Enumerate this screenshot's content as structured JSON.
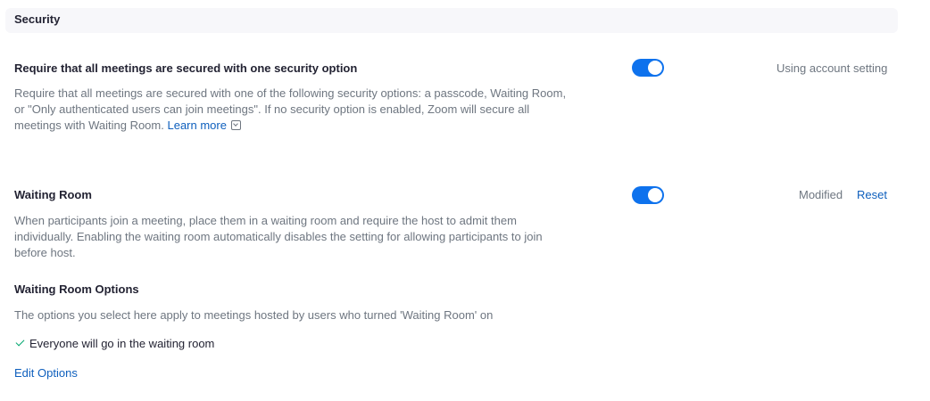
{
  "section": {
    "title": "Security"
  },
  "settings": {
    "require_security": {
      "title": "Require that all meetings are secured with one security option",
      "description": "Require that all meetings are secured with one of the following security options: a passcode, Waiting Room, or \"Only authenticated users can join meetings\". If no security option is enabled, Zoom will secure all meetings with Waiting Room.",
      "learn_more": "Learn more",
      "enabled": true,
      "status": "Using account setting"
    },
    "waiting_room": {
      "title": "Waiting Room",
      "description": "When participants join a meeting, place them in a waiting room and require the host to admit them individually. Enabling the waiting room automatically disables the setting for allowing participants to join before host.",
      "enabled": true,
      "status": "Modified",
      "reset_label": "Reset"
    }
  },
  "waiting_room_options": {
    "title": "Waiting Room Options",
    "description": "The options you select here apply to meetings hosted by users who turned 'Waiting Room' on",
    "selected_option": "Everyone will go in the waiting room",
    "edit_label": "Edit Options"
  },
  "icons": {
    "check": "check-icon",
    "external_link": "external-link-icon"
  },
  "colors": {
    "toggle_on": "#0e72ed",
    "link": "#0e5fbd",
    "check": "#00a66e"
  }
}
